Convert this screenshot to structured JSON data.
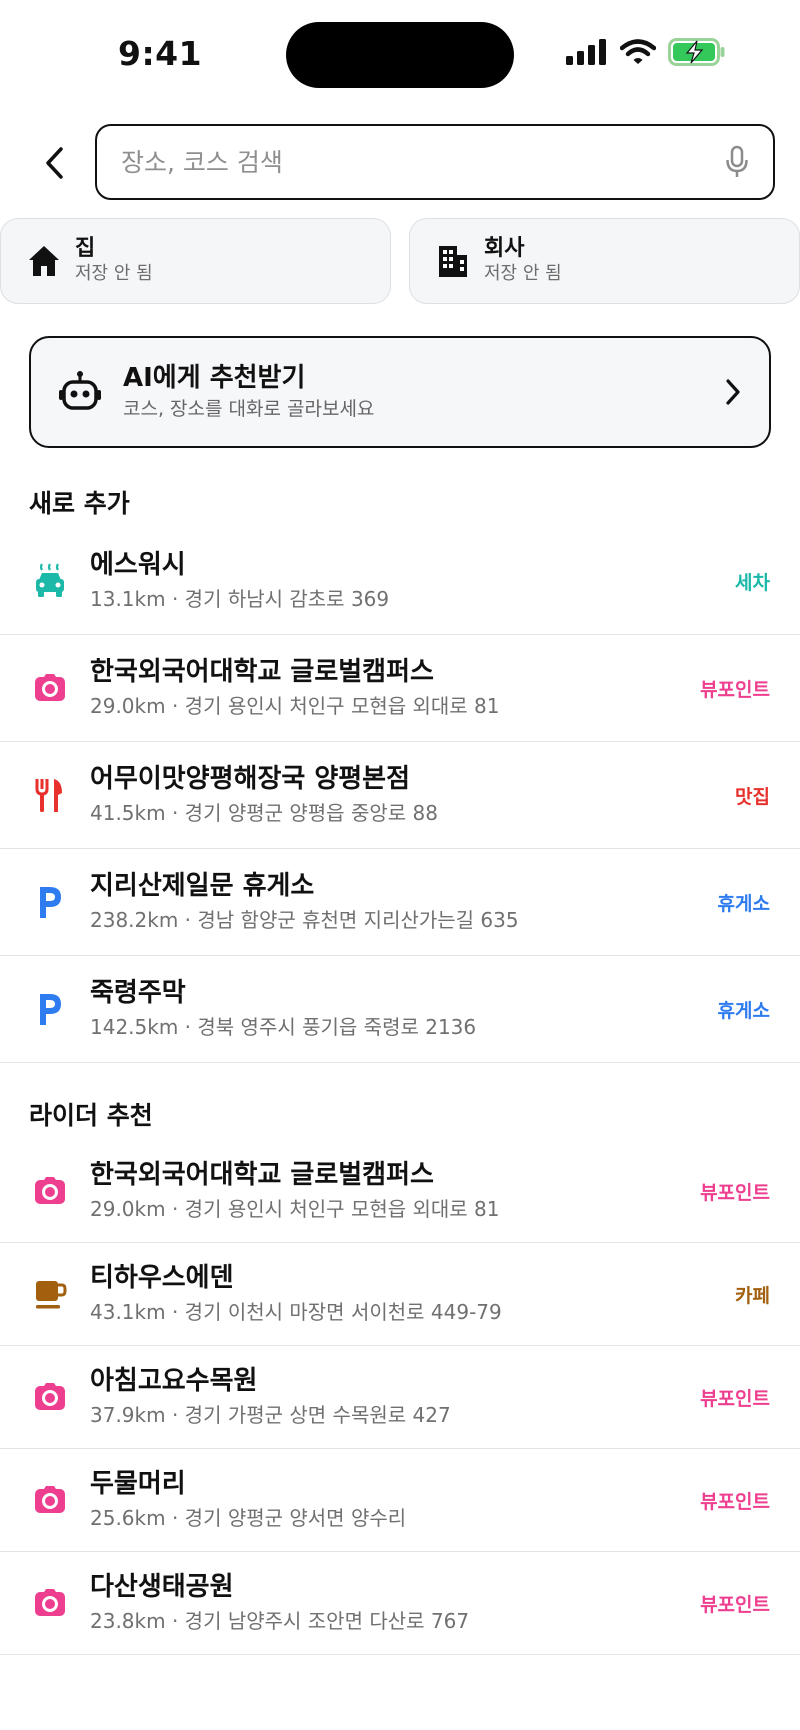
{
  "status_bar": {
    "time": "9:41"
  },
  "search": {
    "placeholder": "장소, 코스 검색"
  },
  "shortcuts": [
    {
      "title": "집",
      "subtitle": "저장 안 됨",
      "icon": "home-icon"
    },
    {
      "title": "회사",
      "subtitle": "저장 안 됨",
      "icon": "building-icon"
    }
  ],
  "ai_card": {
    "title": "AI에게 추천받기",
    "subtitle": "코스, 장소를 대화로 골라보세요"
  },
  "sections": {
    "new": {
      "title": "새로 추가",
      "items": [
        {
          "name": "에스워시",
          "meta": "13.1km · 경기 하남시 감초로 369",
          "tag": "세차",
          "icon": "carwash-icon",
          "color": "#1cb8a8"
        },
        {
          "name": "한국외국어대학교 글로벌캠퍼스",
          "meta": "29.0km · 경기 용인시 처인구 모현읍 외대로 81",
          "tag": "뷰포인트",
          "icon": "camera-icon",
          "color": "#ee3e8f"
        },
        {
          "name": "어무이맛양평해장국 양평본점",
          "meta": "41.5km · 경기 양평군 양평읍 중앙로 88",
          "tag": "맛집",
          "icon": "restaurant-icon",
          "color": "#e8312c"
        },
        {
          "name": "지리산제일문 휴게소",
          "meta": "238.2km · 경남 함양군 휴천면 지리산가는길 635",
          "tag": "휴게소",
          "icon": "parking-icon",
          "color": "#2f7cf0"
        },
        {
          "name": "죽령주막",
          "meta": "142.5km · 경북 영주시 풍기읍 죽령로 2136",
          "tag": "휴게소",
          "icon": "parking-icon",
          "color": "#2f7cf0"
        }
      ]
    },
    "rider": {
      "title": "라이더 추천",
      "items": [
        {
          "name": "한국외국어대학교 글로벌캠퍼스",
          "meta": "29.0km · 경기 용인시 처인구 모현읍 외대로 81",
          "tag": "뷰포인트",
          "icon": "camera-icon",
          "color": "#ee3e8f"
        },
        {
          "name": "티하우스에덴",
          "meta": "43.1km · 경기 이천시 마장면 서이천로 449-79",
          "tag": "카페",
          "icon": "coffee-icon",
          "color": "#a2600e"
        },
        {
          "name": "아침고요수목원",
          "meta": "37.9km · 경기 가평군 상면 수목원로 427",
          "tag": "뷰포인트",
          "icon": "camera-icon",
          "color": "#ee3e8f"
        },
        {
          "name": "두물머리",
          "meta": "25.6km · 경기 양평군 양서면 양수리",
          "tag": "뷰포인트",
          "icon": "camera-icon",
          "color": "#ee3e8f"
        },
        {
          "name": "다산생태공원",
          "meta": "23.8km · 경기 남양주시 조안면 다산로 767",
          "tag": "뷰포인트",
          "icon": "camera-icon",
          "color": "#ee3e8f"
        }
      ]
    }
  }
}
